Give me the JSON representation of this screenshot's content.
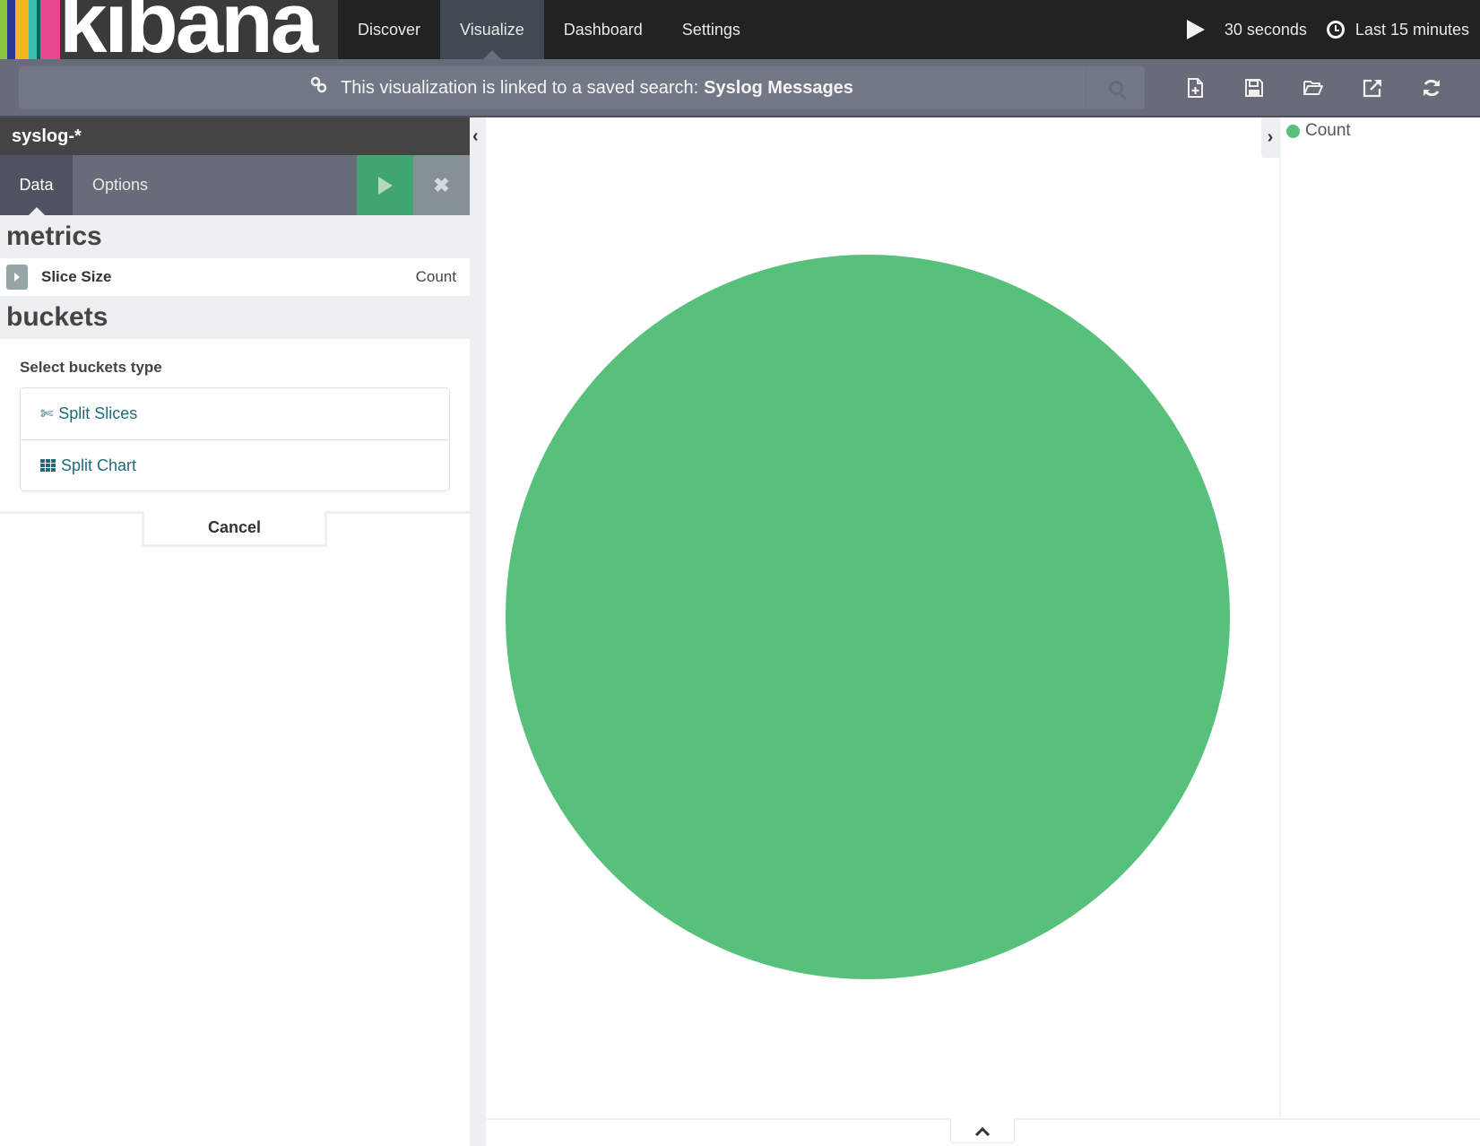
{
  "app": {
    "logo_text": "kibana",
    "logo_bar_colors": [
      "#8cc63f",
      "#2b3990",
      "#f4b71c",
      "#3ebeb0",
      "#00665e",
      "#e8488b"
    ]
  },
  "nav": {
    "links": [
      {
        "label": "Discover",
        "active": false
      },
      {
        "label": "Visualize",
        "active": true
      },
      {
        "label": "Dashboard",
        "active": false
      },
      {
        "label": "Settings",
        "active": false
      }
    ],
    "refresh_interval": "30 seconds",
    "time_range": "Last 15 minutes",
    "refresh_icon": "play-icon",
    "time_icon": "clock-icon"
  },
  "searchbar": {
    "linked_text": "This visualization is linked to a saved search:",
    "saved_search_name": "Syslog Messages",
    "link_icon": "chain-link-icon",
    "search_icon": "magnifier-icon"
  },
  "toolbar": {
    "icons": [
      "new-visualization-icon",
      "save-icon",
      "open-icon",
      "share-icon",
      "refresh-icon"
    ]
  },
  "sidebar": {
    "index_pattern": "syslog-*",
    "tabs": [
      {
        "label": "Data",
        "active": true
      },
      {
        "label": "Options",
        "active": false
      }
    ],
    "apply_icon": "play-icon",
    "discard_icon": "close-icon",
    "discard_glyph": "✖",
    "metrics_title": "metrics",
    "metric": {
      "name": "Slice Size",
      "aggregation": "Count"
    },
    "buckets_title": "buckets",
    "buckets_prompt": "Select buckets type",
    "bucket_options": [
      {
        "label": "Split Slices",
        "icon": "scissors-icon",
        "glyph": "✄"
      },
      {
        "label": "Split Chart",
        "icon": "grid-icon"
      }
    ],
    "cancel_label": "Cancel",
    "collapse_glyph": "‹"
  },
  "legend": {
    "toggle_glyph": "›",
    "items": [
      {
        "label": "Count",
        "color": "#57c17b"
      }
    ]
  },
  "spy": {
    "toggle_glyph": "^"
  },
  "chart_data": {
    "type": "pie",
    "title": "",
    "slices": [
      {
        "label": "Count",
        "value": 1,
        "fraction": 1.0,
        "color": "#57c17b"
      }
    ],
    "legend": "right"
  }
}
